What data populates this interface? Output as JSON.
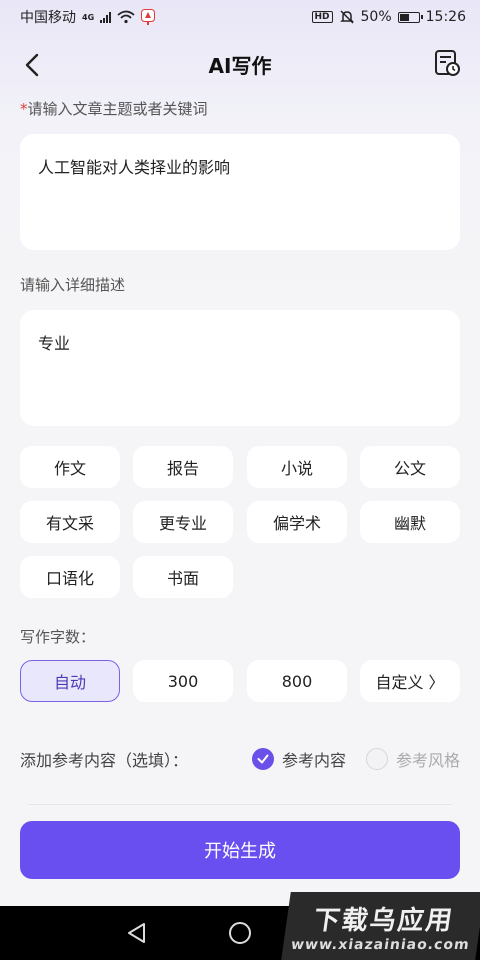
{
  "status_bar": {
    "carrier": "中国移动",
    "network": "4G",
    "hd": "HD",
    "battery_pct": "50%",
    "battery_level": 0.5,
    "time": "15:26"
  },
  "header": {
    "title": "AI写作"
  },
  "topic": {
    "required_mark": "*",
    "label": "请输入文章主题或者关键词",
    "value": "人工智能对人类择业的影响"
  },
  "detail": {
    "label": "请输入详细描述",
    "value": "专业"
  },
  "styles": [
    "作文",
    "报告",
    "小说",
    "公文",
    "有文采",
    "更专业",
    "偏学术",
    "幽默",
    "口语化",
    "书面"
  ],
  "word_count": {
    "label": "写作字数：",
    "options": [
      "自动",
      "300",
      "800",
      "自定义 〉"
    ],
    "selected": "自动"
  },
  "reference": {
    "label": "添加参考内容（选填）：",
    "option_content": "参考内容",
    "option_style": "参考风格",
    "selected": "参考内容"
  },
  "start_button": "开始生成",
  "watermark": {
    "main": "下载乌应用",
    "sub": "www.xiazainiao.com"
  },
  "colors": {
    "accent": "#6a4ff0",
    "required": "#e23b3b",
    "chip_selected_bg": "#e9e7fb"
  }
}
